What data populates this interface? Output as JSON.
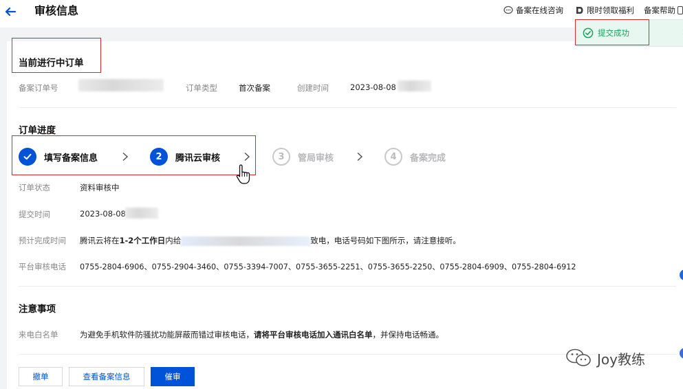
{
  "header": {
    "back_icon": "arrow-left-icon",
    "title": "审核信息",
    "links": {
      "consult": "备案在线咨询",
      "benefit": "限时领取福利",
      "help": "备案帮助"
    }
  },
  "toast": {
    "text": "提交成功",
    "status_color": "#1aa05a"
  },
  "current_order": {
    "title": "当前进行中订单",
    "order_no_label": "备案订单号",
    "order_type_label": "订单类型",
    "order_type_value": "首次备案",
    "created_label": "创建时间",
    "created_value": "2023-08-08"
  },
  "progress": {
    "title": "订单进度",
    "steps": [
      {
        "num": "1",
        "label": "填写备案信息",
        "state": "done"
      },
      {
        "num": "2",
        "label": "腾讯云审核",
        "state": "active"
      },
      {
        "num": "3",
        "label": "管局审核",
        "state": "pending"
      },
      {
        "num": "4",
        "label": "备案完成",
        "state": "pending"
      }
    ],
    "status_label": "订单状态",
    "status_value": "资料审核中",
    "submit_label": "提交时间",
    "submit_value": "2023-08-08",
    "eta_label": "预计完成时间",
    "eta_prefix": "腾讯云将在",
    "eta_bold": "1-2个工作日",
    "eta_mid": "内给",
    "eta_suffix": "致电，电话号码如下图所示，请注意接听。",
    "phone_label": "平台审核电话",
    "phone_value": "0755-2804-6906、0755-2904-3460、0755-3394-7007、0755-3655-2251、0755-3655-2250、0755-2804-6909、0755-2804-6912"
  },
  "notes": {
    "title": "注意事项",
    "whitelist_label": "来电白名单",
    "whitelist_prefix": "为避免手机软件防骚扰功能屏蔽而错过审核电话，",
    "whitelist_bold": "请将平台审核电话加入通讯白名单",
    "whitelist_suffix": "，并保持电话畅通。"
  },
  "actions": {
    "cancel": "撤单",
    "view": "查看备案信息",
    "urge": "催审"
  },
  "watermark": {
    "text": "Joy教练"
  },
  "colors": {
    "accent": "#0052d9",
    "highlight": "#d6292c"
  }
}
